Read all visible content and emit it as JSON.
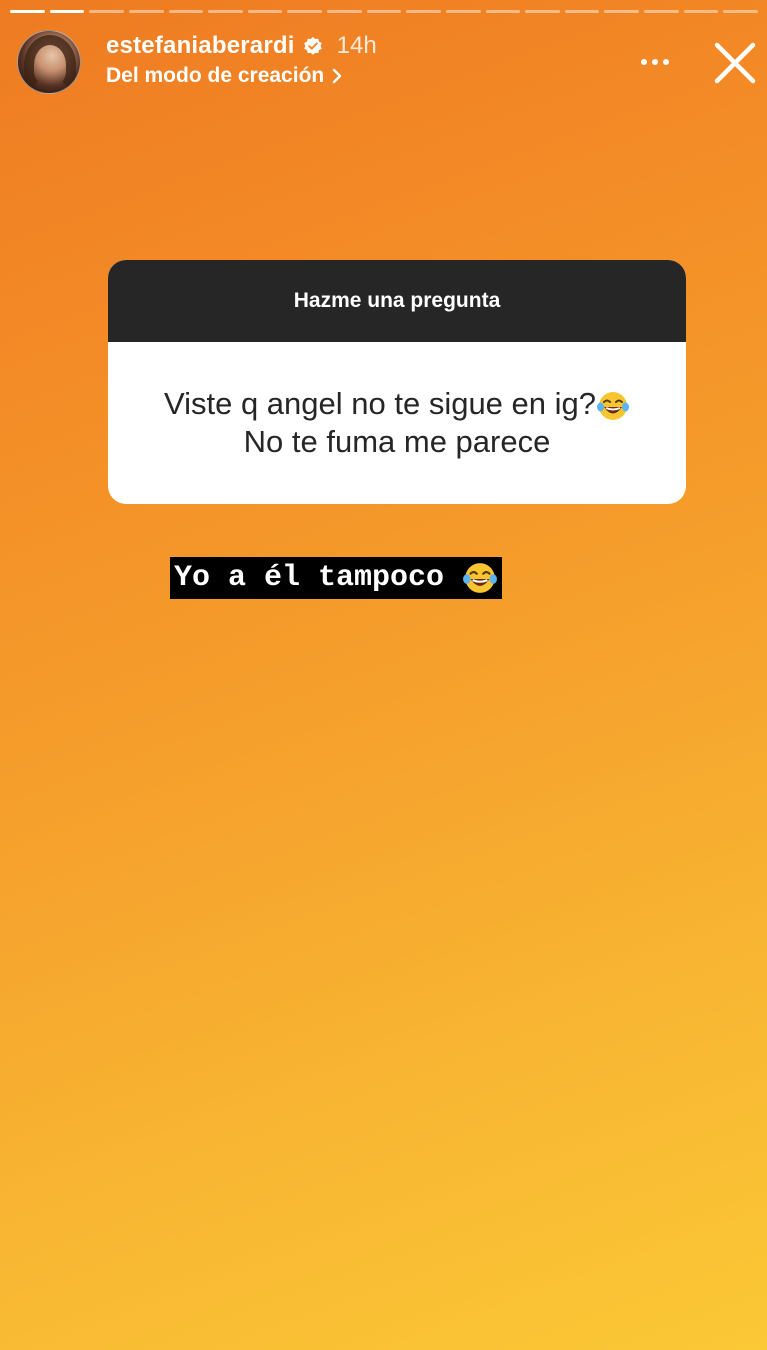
{
  "story": {
    "segments_total": 19,
    "segments_done": 2,
    "background_from": "#ee7b22",
    "background_to": "#fbc836"
  },
  "header": {
    "username": "estefaniaberardi",
    "time": "14h",
    "subtitle": "Del modo de creación",
    "icons": [
      "verified-badge-icon",
      "chevron-right-icon",
      "more-options-icon",
      "close-icon"
    ]
  },
  "question_card": {
    "title": "Hazme una pregunta",
    "line1": "Viste q angel no te sigue en ig?",
    "line2": "No te fuma me parece",
    "emoji": "laughing-tears-emoji"
  },
  "reply": {
    "text": "Yo a él tampoco",
    "emoji": "laughing-tears-emoji"
  }
}
